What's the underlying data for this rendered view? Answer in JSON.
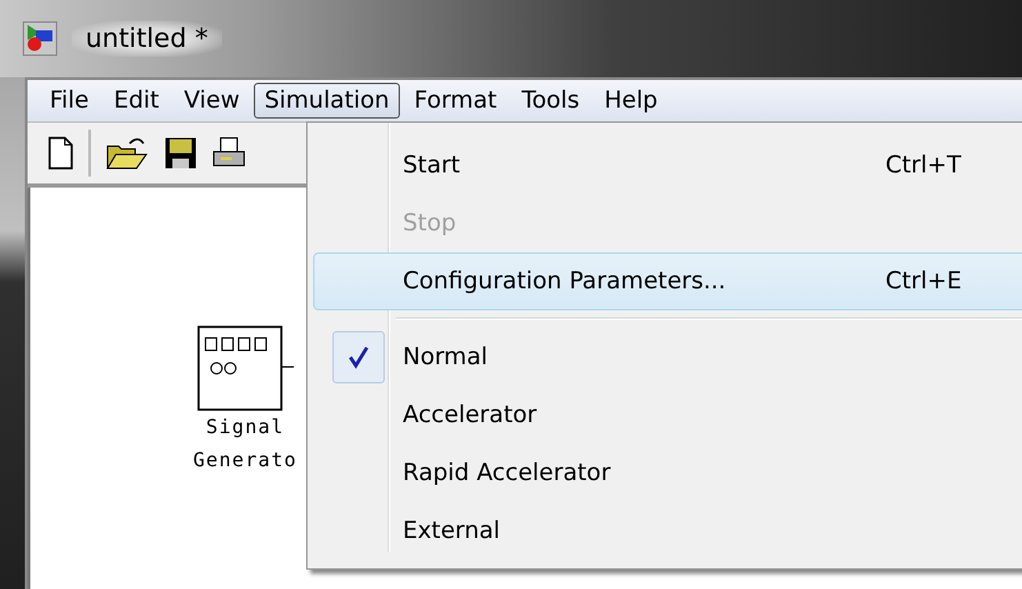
{
  "window": {
    "title": "untitled *"
  },
  "menubar": [
    {
      "label": "File",
      "selected": false
    },
    {
      "label": "Edit",
      "selected": false
    },
    {
      "label": "View",
      "selected": false
    },
    {
      "label": "Simulation",
      "selected": true
    },
    {
      "label": "Format",
      "selected": false
    },
    {
      "label": "Tools",
      "selected": false
    },
    {
      "label": "Help",
      "selected": false
    }
  ],
  "canvas": {
    "block": {
      "label_lines": [
        "Signal",
        "Generato"
      ]
    }
  },
  "menu": [
    {
      "kind": "item",
      "label": "Start",
      "shortcut": "Ctrl+T",
      "disabled": false,
      "highlighted": false,
      "checked": false
    },
    {
      "kind": "item",
      "label": "Stop",
      "disabled": true,
      "highlighted": false,
      "checked": false
    },
    {
      "kind": "item",
      "label": "Configuration Parameters...",
      "shortcut": "Ctrl+E",
      "disabled": false,
      "highlighted": true,
      "checked": false
    },
    {
      "kind": "separator"
    },
    {
      "kind": "item",
      "label": "Normal",
      "disabled": false,
      "highlighted": false,
      "checked": true
    },
    {
      "kind": "item",
      "label": "Accelerator",
      "disabled": false,
      "highlighted": false,
      "checked": false
    },
    {
      "kind": "item",
      "label": "Rapid Accelerator",
      "disabled": false,
      "highlighted": false,
      "checked": false
    },
    {
      "kind": "item",
      "label": "External",
      "disabled": false,
      "highlighted": false,
      "checked": false
    }
  ]
}
